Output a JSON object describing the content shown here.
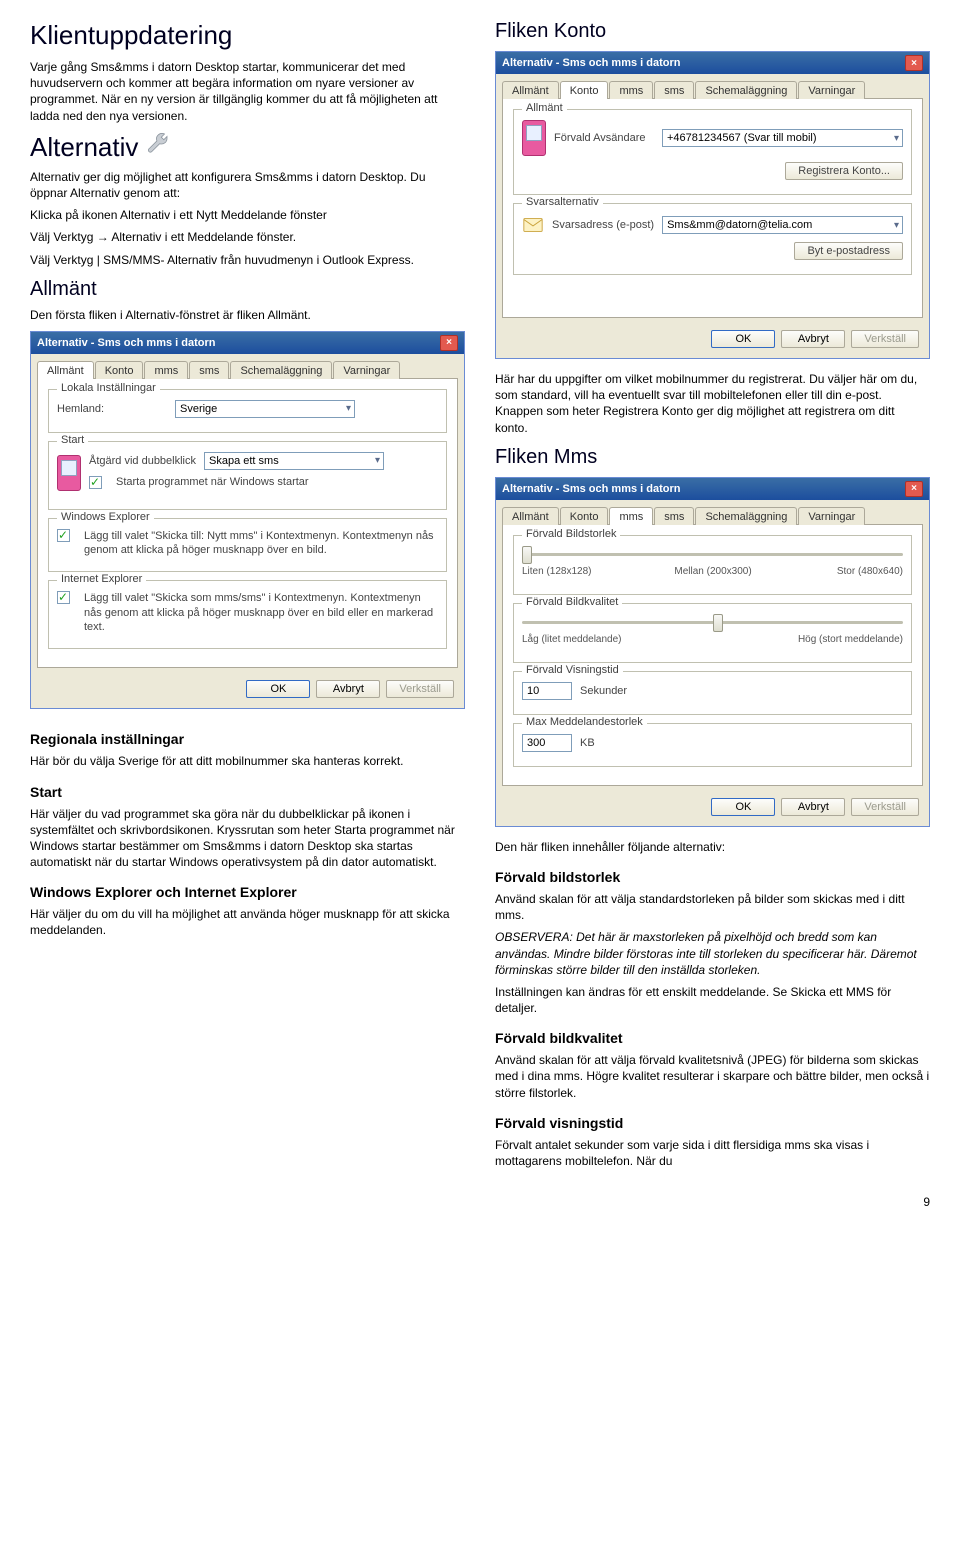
{
  "page_number": "9",
  "left": {
    "heading_klient": "Klientuppdatering",
    "klient_p1": "Varje gång Sms&mms i datorn Desktop startar, kommunicerar det med huvudservern och kommer att begära information om nyare versioner av programmet. När en ny version är tillgänglig kommer du att få möjligheten att ladda ned den nya versionen.",
    "heading_alt": "Alternativ",
    "alt_p1": "Alternativ ger dig möjlighet att konfigurera Sms&mms i datorn Desktop. Du öppnar Alternativ genom att:",
    "alt_p2": "Klicka på ikonen Alternativ i ett Nytt Meddelande fönster",
    "alt_p3": "Välj Verktyg → Alternativ i ett Meddelande fönster.",
    "alt_p4": "Välj Verktyg | SMS/MMS- Alternativ från huvudmenyn i Outlook Express.",
    "heading_allmant": "Allmänt",
    "allmant_p": "Den första fliken i Alternativ-fönstret är fliken Allmänt.",
    "dialog_allmant": {
      "title": "Alternativ - Sms och mms i datorn",
      "tabs": [
        "Allmänt",
        "Konto",
        "mms",
        "sms",
        "Schemaläggning",
        "Varningar"
      ],
      "grp_local": "Lokala Inställningar",
      "label_home": "Hemland:",
      "home_value": "Sverige",
      "grp_start": "Start",
      "label_action": "Åtgärd vid dubbelklick",
      "action_value": "Skapa ett sms",
      "chk_startup": "Starta programmet när Windows startar",
      "grp_winexp": "Windows Explorer",
      "chk_winexp": "Lägg till valet \"Skicka till: Nytt mms\" i Kontextmenyn. Kontextmenyn nås genom att klicka på höger musknapp över en bild.",
      "grp_ie": "Internet Explorer",
      "chk_ie": "Lägg till valet \"Skicka som mms/sms\" i Kontextmenyn. Kontextmenyn nås genom att klicka på höger musknapp över en bild eller en markerad text.",
      "btn_ok": "OK",
      "btn_cancel": "Avbryt",
      "btn_apply": "Verkställ"
    },
    "heading_regionala": "Regionala inställningar",
    "regionala_p": "Här bör du välja Sverige för att ditt mobilnummer ska hanteras korrekt.",
    "heading_start": "Start",
    "start_p": "Här väljer du vad programmet ska göra när du dubbelklickar på ikonen i systemfältet och skrivbordsikonen. Kryssrutan som heter Starta programmet när Windows startar bestämmer om Sms&mms i datorn Desktop ska startas automatiskt när du startar Windows operativsystem på din dator automatiskt.",
    "heading_explorer": "Windows Explorer och Internet Explorer",
    "explorer_p": "Här väljer du om du vill ha möjlighet att använda höger musknapp för att skicka meddelanden."
  },
  "right": {
    "heading_konto": "Fliken Konto",
    "dialog_konto": {
      "title": "Alternativ - Sms och mms i datorn",
      "tabs": [
        "Allmänt",
        "Konto",
        "mms",
        "sms",
        "Schemaläggning",
        "Varningar"
      ],
      "grp_allmant": "Allmänt",
      "label_sender": "Förvald Avsändare",
      "sender_value": "+46781234567 (Svar till mobil)",
      "btn_reg": "Registrera Konto...",
      "grp_svars": "Svarsalternativ",
      "label_reply": "Svarsadress (e-post)",
      "reply_value": "Sms&mm@datorn@telia.com",
      "btn_change": "Byt e-postadress",
      "btn_ok": "OK",
      "btn_cancel": "Avbryt",
      "btn_apply": "Verkställ"
    },
    "konto_p": "Här har du uppgifter om vilket mobilnummer du registrerat. Du väljer här om du, som standard, vill ha eventuellt svar till mobiltelefonen eller till din e-post. Knappen som heter Registrera Konto ger dig möjlighet att registrera om ditt konto.",
    "heading_mms": "Fliken Mms",
    "dialog_mms": {
      "title": "Alternativ - Sms och mms i datorn",
      "tabs": [
        "Allmänt",
        "Konto",
        "mms",
        "sms",
        "Schemaläggning",
        "Varningar"
      ],
      "grp_size": "Förvald Bildstorlek",
      "size_a": "Liten (128x128)",
      "size_b": "Mellan (200x300)",
      "size_c": "Stor (480x640)",
      "grp_quality": "Förvald Bildkvalitet",
      "q_low": "Låg (litet meddelande)",
      "q_high": "Hög (stort meddelande)",
      "grp_view": "Förvald Visningstid",
      "view_val": "10",
      "view_unit": "Sekunder",
      "grp_max": "Max Meddelandestorlek",
      "max_val": "300",
      "max_unit": "KB",
      "btn_ok": "OK",
      "btn_cancel": "Avbryt",
      "btn_apply": "Verkställ"
    },
    "mms_p1": "Den här fliken innehåller följande alternativ:",
    "heading_bildstorlek": "Förvald bildstorlek",
    "bildstorlek_p1": "Använd skalan för att välja standardstorleken på bilder som skickas med i ditt mms.",
    "bildstorlek_obs": "OBSERVERA: Det här är maxstorleken på pixelhöjd och bredd som kan användas. Mindre bilder förstoras inte till storleken du specificerar här. Däremot förminskas större bilder till den inställda storleken.",
    "bildstorlek_p2": "Inställningen kan ändras för ett enskilt meddelande. Se Skicka ett MMS för detaljer.",
    "heading_bildkvalitet": "Förvald bildkvalitet",
    "bildkvalitet_p": "Använd skalan för att välja förvald kvalitetsnivå (JPEG) för bilderna som skickas med i dina mms. Högre kvalitet resulterar i skarpare och bättre bilder, men också i större filstorlek.",
    "heading_visning": "Förvald visningstid",
    "visning_p": "Förvalt antalet sekunder som varje sida i ditt flersidiga mms ska visas i mottagarens mobiltelefon. När du"
  }
}
